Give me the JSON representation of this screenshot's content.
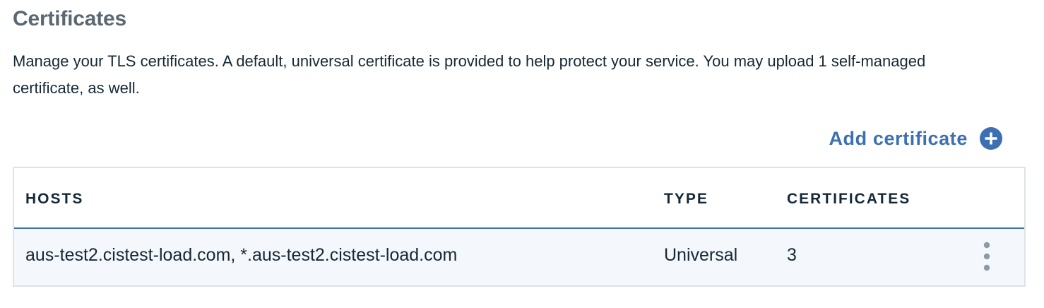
{
  "header": {
    "title": "Certificates",
    "description": "Manage your TLS certificates. A default, universal certificate is provided to help protect your service. You may upload 1 self-managed certificate, as well."
  },
  "actions": {
    "add_label": "Add certificate",
    "add_icon": "plus-circle-icon"
  },
  "colors": {
    "accent": "#3d70b2",
    "title": "#5a6872",
    "text": "#152935",
    "row_bg": "#f4f7fb",
    "border": "#dfe3e6"
  },
  "table": {
    "columns": [
      "HOSTS",
      "TYPE",
      "CERTIFICATES"
    ],
    "rows": [
      {
        "hosts": "aus-test2.cistest-load.com, *.aus-test2.cistest-load.com",
        "type": "Universal",
        "certificates": "3",
        "menu_icon": "overflow-menu-vertical-icon"
      }
    ]
  }
}
